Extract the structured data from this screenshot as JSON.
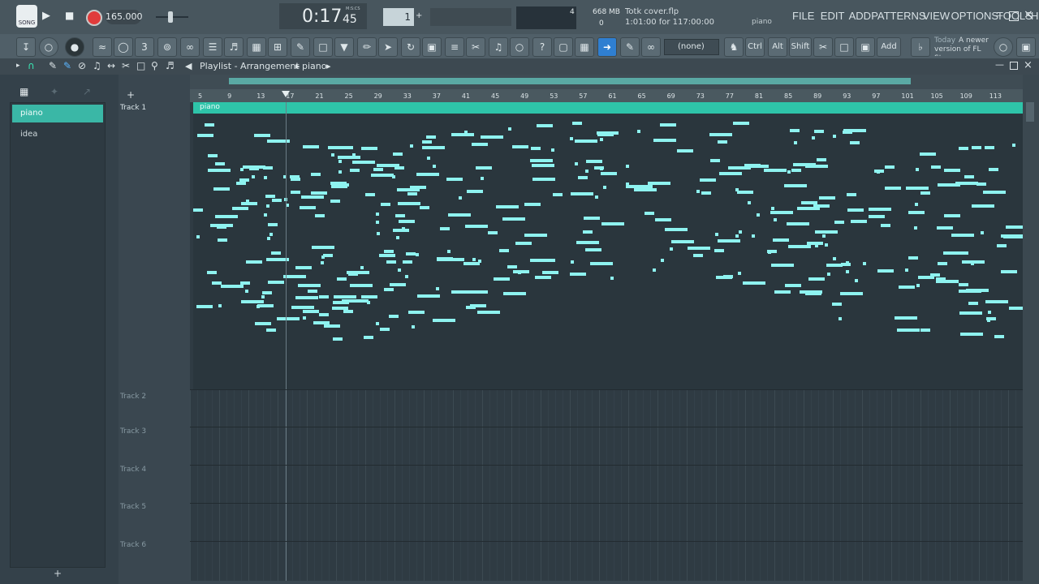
{
  "top": {
    "song_button": "SONG",
    "tempo": "165.000",
    "time_display": "0:17",
    "time_sub": "45",
    "time_label": "M:S:CS",
    "pattern_num": "1",
    "cpu_value": "4",
    "mem": "668 MB",
    "polyphony": "0",
    "project_name": "Totk cover.flp",
    "hint_time": "1:01:00 for 117:00:00",
    "hint_right": "piano",
    "menu": [
      "FILE",
      "EDIT",
      "ADD",
      "PATTERNS",
      "VIEW",
      "OPTIONS",
      "TOOLS",
      "HELP"
    ]
  },
  "toolbar": {
    "channel_selector": "(none)",
    "ctrl_label": "Ctrl",
    "alt_label": "Alt",
    "shift_label": "Shift",
    "add_label": "Add",
    "news_title": "Today",
    "news_text": "A newer version of FL Stu..."
  },
  "playlist": {
    "breadcrumb": "Playlist - Arrangement",
    "breadcrumb_item": "piano",
    "patterns": [
      "piano",
      "idea"
    ],
    "tracks": [
      "Track 1",
      "Track 2",
      "Track 3",
      "Track 4",
      "Track 5",
      "Track 6"
    ],
    "clip_label": "piano",
    "ruler": [
      "5",
      "9",
      "13",
      "17",
      "21",
      "25",
      "29",
      "33",
      "37",
      "41",
      "45",
      "49",
      "53",
      "57",
      "61",
      "65",
      "69",
      "73",
      "77",
      "81",
      "85",
      "89",
      "93",
      "97",
      "101",
      "105",
      "109",
      "113"
    ]
  },
  "colors": {
    "accent": "#3ab7a6",
    "note": "#8ef3f0",
    "clip": "#2ec4a9"
  }
}
